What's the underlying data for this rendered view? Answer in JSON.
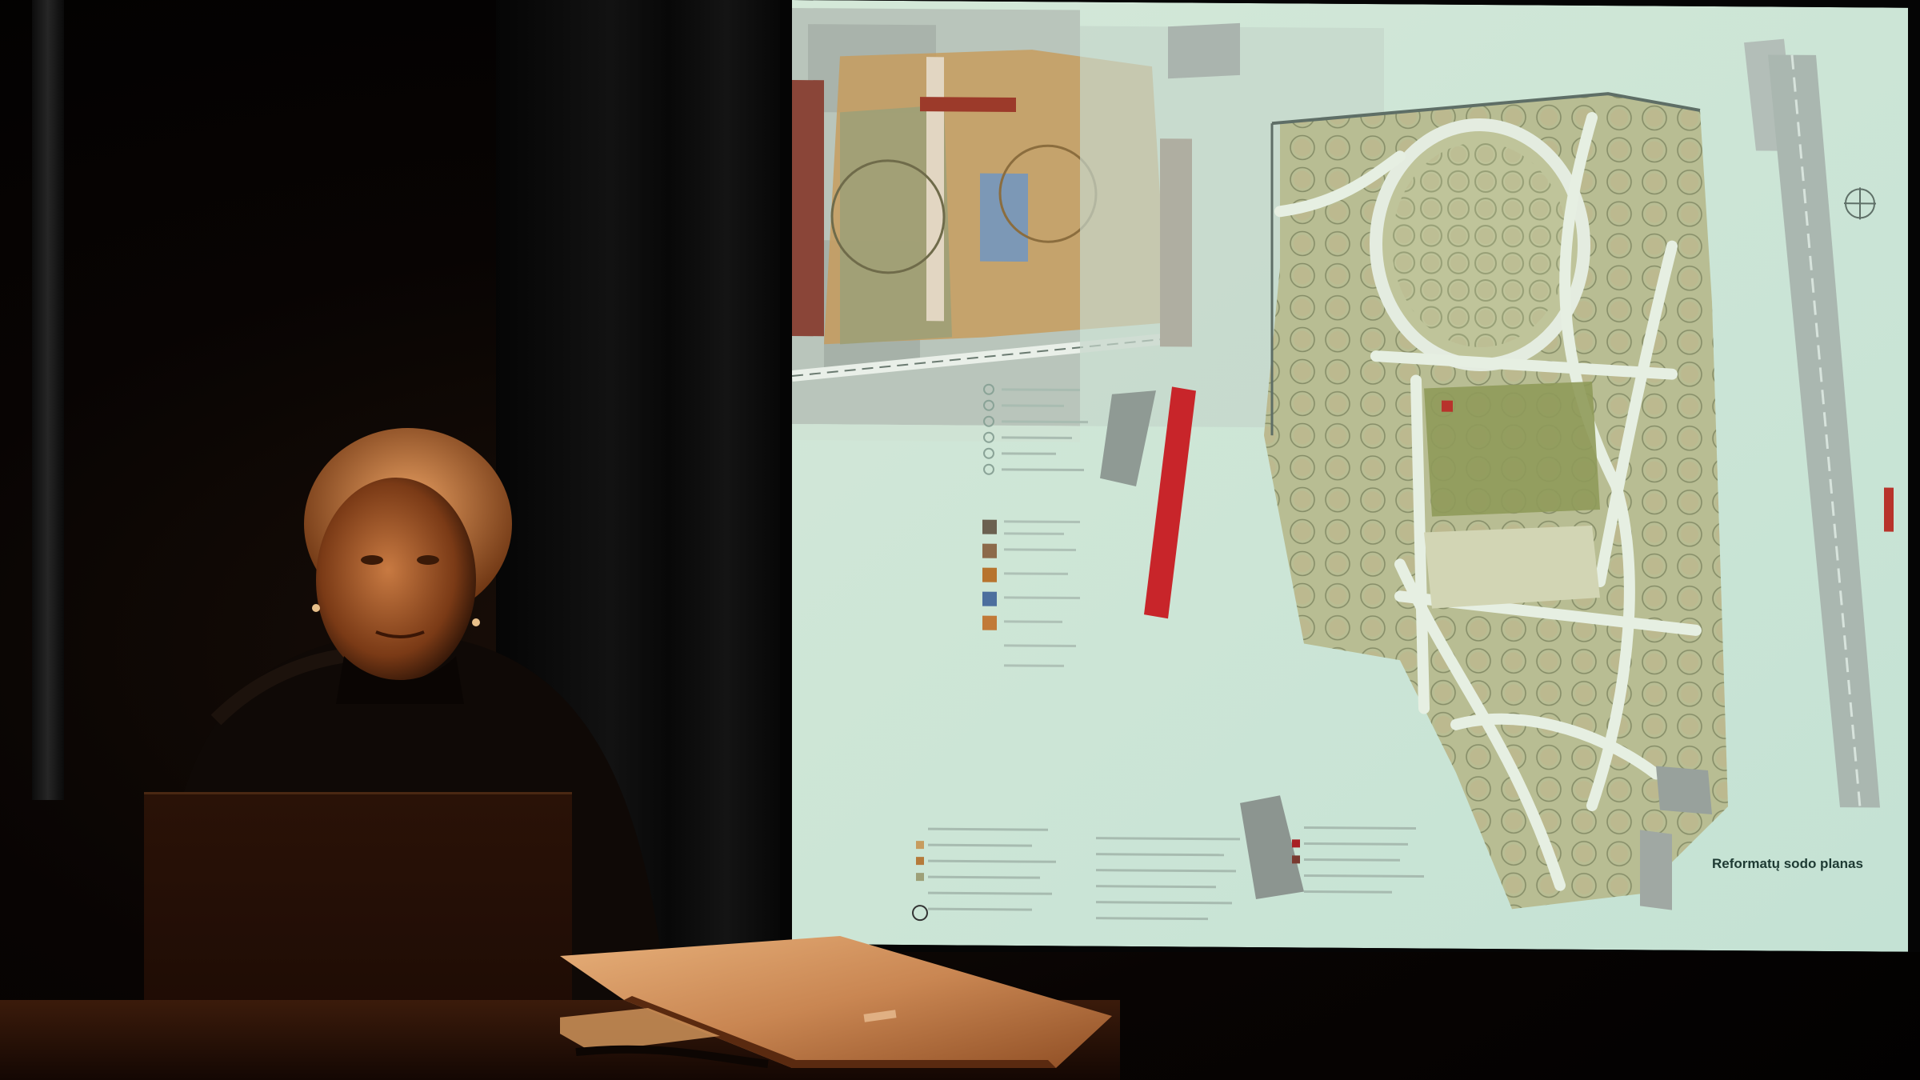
{
  "scene": {
    "description_free": true,
    "screen_caption": "Reformatų sodo planas",
    "colors": {
      "screen_bg": "#cfe6d6",
      "park_green": "#a8b889",
      "paths": "#e6efe2",
      "building_red": "#c8252a",
      "plan_orange": "#c7964e",
      "plan_blue": "#6e8fb0",
      "skin_light": "#d9884a",
      "jacket": "#0f0906"
    }
  }
}
